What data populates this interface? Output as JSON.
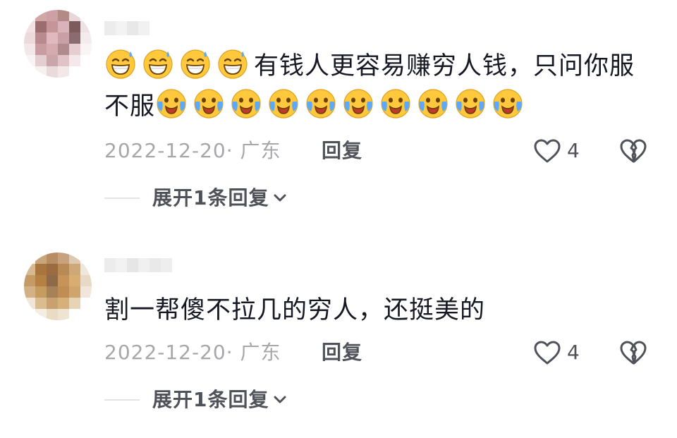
{
  "comments": [
    {
      "avatar_colors": [
        "#f4eaea",
        "#cfa7a5",
        "#cda0a6",
        "#b48a86",
        "#e8d7d9",
        "#f7f0f0",
        "#f0e2e2",
        "#9c6d6f",
        "#c69599",
        "#d8b3b9",
        "#7d5a5c",
        "#eee2e4",
        "#ecd9db",
        "#b98a8f",
        "#e0b9bf",
        "#caa0a6",
        "#8a6c6e",
        "#f4ebec",
        "#f3e8e9",
        "#c99ca1",
        "#d5abb0",
        "#b18a8e",
        "#e6cdd0",
        "#faf4f5",
        "#f9f3f4",
        "#e3cfd1",
        "#caa5a9",
        "#e1c3c6",
        "#f4e8ea",
        "#ffffff",
        "#ffffff",
        "#f7f0f1",
        "#eadadc",
        "#f3e7e8",
        "#ffffff",
        "#ffffff"
      ],
      "username_blur_colors": [
        "#ececec",
        "#f3f3f3",
        "#e8e8e8",
        "#f1f1f1"
      ],
      "segments": [
        {
          "type": "emoji",
          "name": "grin-sweat-icon"
        },
        {
          "type": "emoji",
          "name": "grin-sweat-icon"
        },
        {
          "type": "emoji",
          "name": "grin-sweat-icon"
        },
        {
          "type": "emoji",
          "name": "grin-sweat-icon"
        },
        {
          "type": "text",
          "text": "有钱人更容易赚穷人钱，只问你服不服"
        },
        {
          "type": "emoji",
          "name": "crying-laugh-icon"
        },
        {
          "type": "emoji",
          "name": "crying-laugh-icon"
        },
        {
          "type": "emoji",
          "name": "crying-laugh-icon"
        },
        {
          "type": "emoji",
          "name": "crying-laugh-icon"
        },
        {
          "type": "emoji",
          "name": "crying-laugh-icon"
        },
        {
          "type": "emoji",
          "name": "crying-laugh-icon"
        },
        {
          "type": "emoji",
          "name": "crying-laugh-icon"
        },
        {
          "type": "emoji",
          "name": "crying-laugh-icon"
        },
        {
          "type": "emoji",
          "name": "crying-laugh-icon"
        },
        {
          "type": "emoji",
          "name": "crying-laugh-icon"
        }
      ],
      "date_location": "2022-12-20· 广东",
      "reply_label": "回复",
      "like_count": "4",
      "expand_label": "展开1条回复"
    },
    {
      "avatar_colors": [
        "#f3efe9",
        "#c9a67a",
        "#b98d63",
        "#c7a27d",
        "#ddc9b1",
        "#f6f2ee",
        "#d6b993",
        "#a7753d",
        "#9c6b3f",
        "#b88a55",
        "#cfa877",
        "#efe6dc",
        "#c49a67",
        "#b58143",
        "#8f6a49",
        "#c69358",
        "#d7ad72",
        "#e7d9c6",
        "#d2b285",
        "#c69b5f",
        "#a68257",
        "#c08e55",
        "#cfa56d",
        "#f0e6d9",
        "#efe5d8",
        "#d9bc8f",
        "#c9a171",
        "#d6b07b",
        "#e7d4b5",
        "#ffffff",
        "#ffffff",
        "#f4ede3",
        "#e9dbc4",
        "#efe4d3",
        "#ffffff",
        "#ffffff"
      ],
      "username_blur_colors": [
        "#ececec",
        "#f2f2f2",
        "#e6e6e6",
        "#f0f0f0",
        "#e9e9e9",
        "#eeeeee"
      ],
      "segments": [
        {
          "type": "text",
          "text": "割一帮傻不拉几的穷人，还挺美的"
        }
      ],
      "date_location": "2022-12-20· 广东",
      "reply_label": "回复",
      "like_count": "4",
      "expand_label": "展开1条回复"
    }
  ],
  "colors": {
    "text_primary": "#161823",
    "text_secondary": "#a6a7ab",
    "action_text": "#50525a",
    "emoji_face": "#ffc83d",
    "emoji_tear": "#5aa9ff"
  }
}
